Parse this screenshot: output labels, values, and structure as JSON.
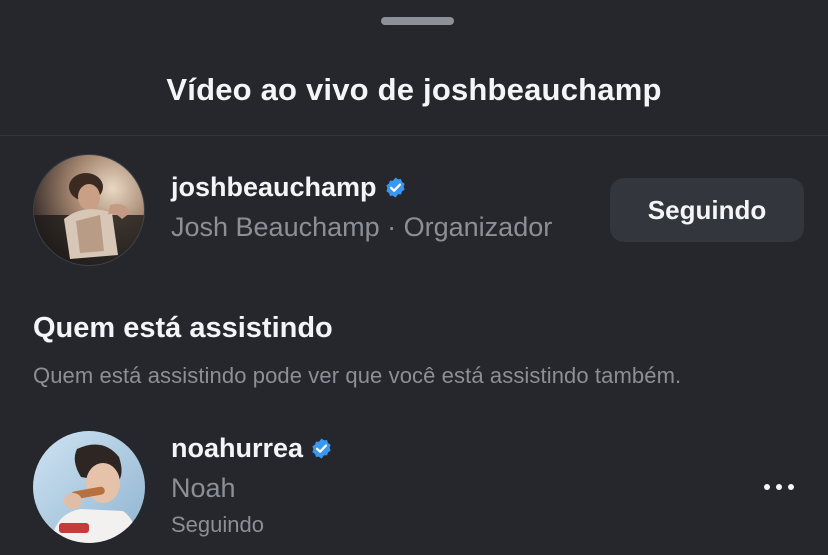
{
  "sheet": {
    "title": "Vídeo ao vivo de joshbeauchamp"
  },
  "host": {
    "username": "joshbeauchamp",
    "verified": true,
    "full_name": "Josh Beauchamp",
    "separator": " · ",
    "role": "Organizador",
    "follow_button_label": "Seguindo",
    "avatar_icon": "profile-photo"
  },
  "watching_section": {
    "title": "Quem está assistindo",
    "description": "Quem está assistindo pode ver que você está assistindo também."
  },
  "viewers": [
    {
      "username": "noahurrea",
      "verified": true,
      "name": "Noah",
      "status": "Seguindo",
      "avatar_icon": "profile-photo",
      "more_icon": "more-horizontal-icon"
    }
  ],
  "colors": {
    "background": "#25272c",
    "button_bg": "#33363d",
    "verified_blue": "#3897f0",
    "secondary_text": "#8c8f96"
  }
}
